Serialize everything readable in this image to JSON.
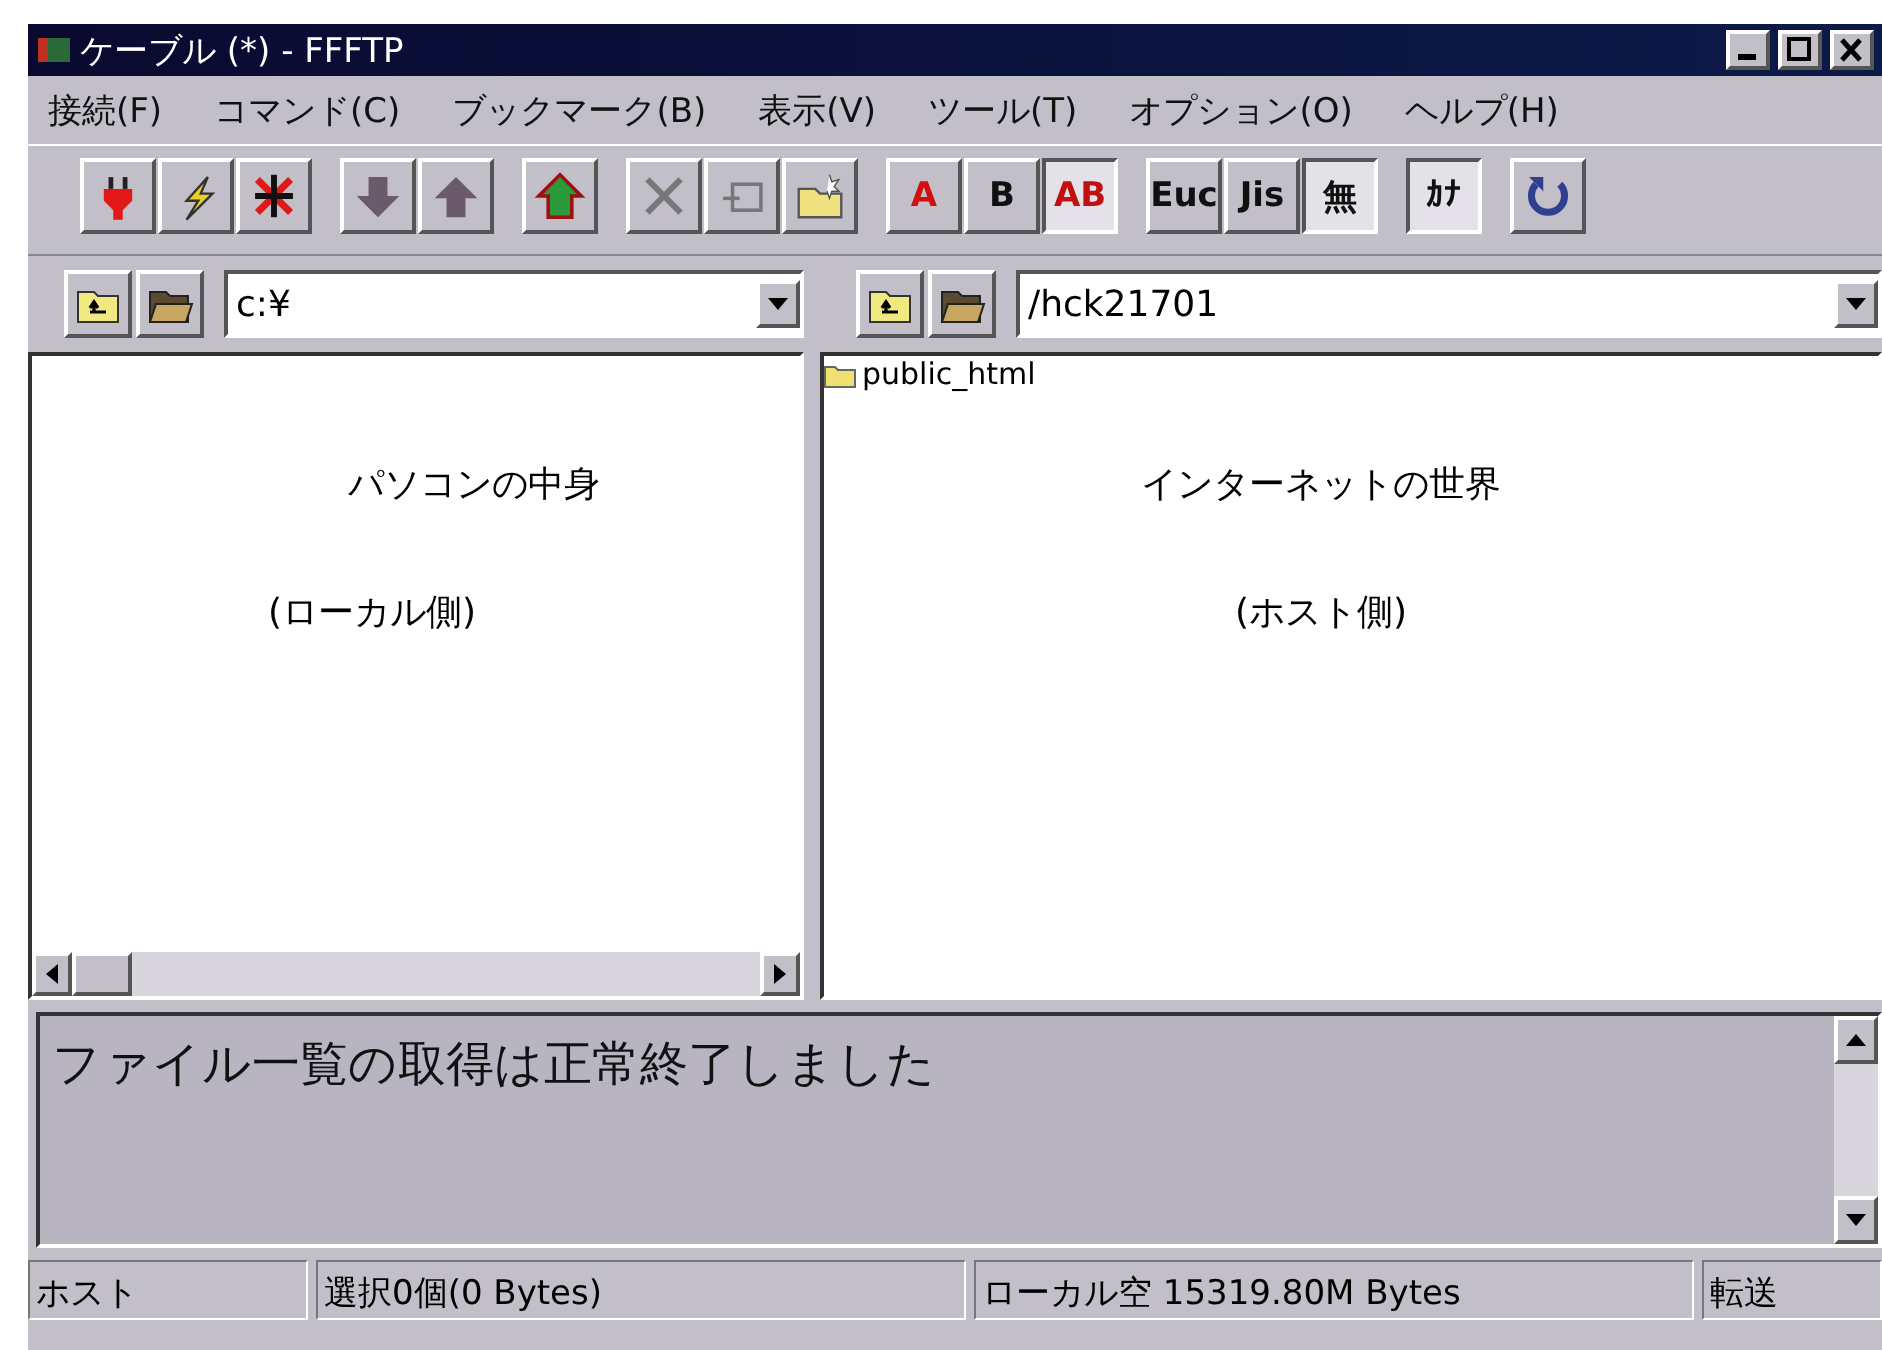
{
  "window": {
    "title": "ケーブル (*) - FFFTP"
  },
  "menu": [
    "接続(F)",
    "コマンド(C)",
    "ブックマーク(B)",
    "表示(V)",
    "ツール(T)",
    "オプション(O)",
    "ヘルプ(H)"
  ],
  "toolbar": [
    [
      {
        "kind": "plug"
      },
      {
        "kind": "bolt"
      },
      {
        "kind": "cross"
      }
    ],
    [
      {
        "kind": "down"
      },
      {
        "kind": "up"
      }
    ],
    [
      {
        "kind": "house"
      }
    ],
    [
      {
        "kind": "delete"
      },
      {
        "kind": "rename"
      },
      {
        "kind": "folder"
      }
    ],
    [
      {
        "kind": "label",
        "label": "A",
        "pressed": false,
        "color": "#d01010"
      },
      {
        "kind": "label",
        "label": "B",
        "pressed": false,
        "color": "#101010"
      },
      {
        "kind": "label",
        "label": "AB",
        "pressed": true,
        "color": "#c01010"
      }
    ],
    [
      {
        "kind": "label",
        "label": "Euc",
        "pressed": false,
        "color": "#101010"
      },
      {
        "kind": "label",
        "label": "Jis",
        "pressed": false,
        "color": "#101010"
      },
      {
        "kind": "label",
        "label": "無",
        "pressed": true,
        "color": "#101010"
      }
    ],
    [
      {
        "kind": "label",
        "label": "ｶﾅ",
        "pressed": true,
        "color": "#101010"
      }
    ],
    [
      {
        "kind": "refresh"
      }
    ]
  ],
  "local": {
    "path": "c:¥",
    "notes": [
      "パソコンの中身",
      "(ローカル側)"
    ]
  },
  "remote": {
    "path": "/hck21701",
    "files": [
      {
        "name": "public_html"
      }
    ],
    "notes": [
      "インターネットの世界",
      "(ホスト側)"
    ]
  },
  "log": "ファイル一覧の取得は正常終了しました",
  "status_bar": [
    "ホスト",
    "選択0個(0 Bytes)",
    "ローカル空 15319.80M Bytes",
    "転送"
  ]
}
